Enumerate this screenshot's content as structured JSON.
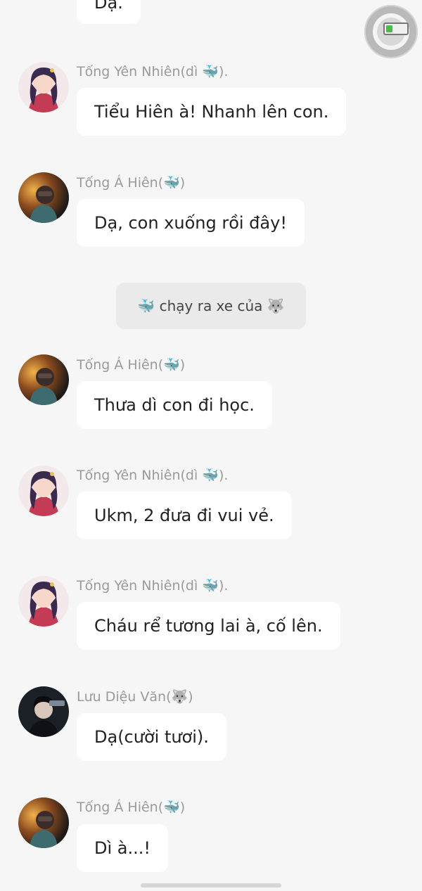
{
  "chat": {
    "top_fragment": "Dạ.",
    "messages": [
      {
        "sender": "Tống Yên Nhiên(dì 🐳).",
        "text": "Tiểu Hiên à! Nhanh lên con.",
        "avatar": "woman-avatar-icon"
      },
      {
        "sender": "Tống Á Hiên(🐳)",
        "text": "Dạ, con xuống rồi đây!",
        "avatar": "boy-avatar-icon"
      },
      {
        "sender": "Tống Á Hiên(🐳)",
        "text": "Thưa dì con đi học.",
        "avatar": "boy-avatar-icon"
      },
      {
        "sender": "Tống Yên Nhiên(dì 🐳).",
        "text": "Ukm, 2 đưa đi vui vẻ.",
        "avatar": "woman-avatar-icon"
      },
      {
        "sender": "Tống Yên Nhiên(dì 🐳).",
        "text": "Cháu rể tương lai à, cố lên.",
        "avatar": "woman-avatar-icon"
      },
      {
        "sender": "Lưu Diệu Văn(🐺)",
        "text": "Dạ(cười tươi).",
        "avatar": "man-avatar-icon"
      },
      {
        "sender": "Tống Á Hiên(🐳)",
        "text": "Dì à...!",
        "avatar": "boy-avatar-icon"
      }
    ],
    "narration": "🐳 chạy ra xe của 🐺"
  },
  "floating_button": {
    "icon": "battery-icon"
  }
}
